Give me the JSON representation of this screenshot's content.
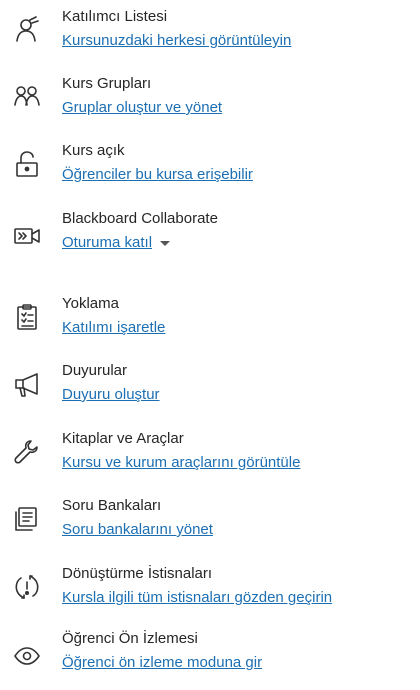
{
  "colors": {
    "link": "#1c6fb3",
    "title": "#262626",
    "icon": "#333333"
  },
  "items": [
    {
      "icon": "person-icon",
      "title": "Katılımcı Listesi",
      "link": "Kursunuzdaki herkesi görüntüleyin"
    },
    {
      "icon": "people-icon",
      "title": "Kurs Grupları",
      "link": "Gruplar oluştur ve yönet"
    },
    {
      "icon": "unlock-icon",
      "title": "Kurs açık",
      "link": "Öğrenciler bu kursa erişebilir"
    },
    {
      "icon": "video-camera-icon",
      "title": "Blackboard Collaborate",
      "link": "Oturuma katıl"
    },
    {
      "icon": "clipboard-icon",
      "title": "Yoklama",
      "link": "Katılımı işaretle"
    },
    {
      "icon": "megaphone-icon",
      "title": "Duyurular",
      "link": "Duyuru oluştur"
    },
    {
      "icon": "wrench-icon",
      "title": "Kitaplar ve Araçlar",
      "link": "Kursu ve kurum araçlarını görüntüle"
    },
    {
      "icon": "question-bank-icon",
      "title": "Soru Bankaları",
      "link": "Soru bankalarını yönet"
    },
    {
      "icon": "exception-icon",
      "title": "Dönüştürme İstisnaları",
      "link": "Kursla ilgili tüm istisnaları gözden geçirin"
    },
    {
      "icon": "eye-icon",
      "title": "Öğrenci Ön İzlemesi",
      "link": "Öğrenci ön izleme moduna gir"
    }
  ]
}
